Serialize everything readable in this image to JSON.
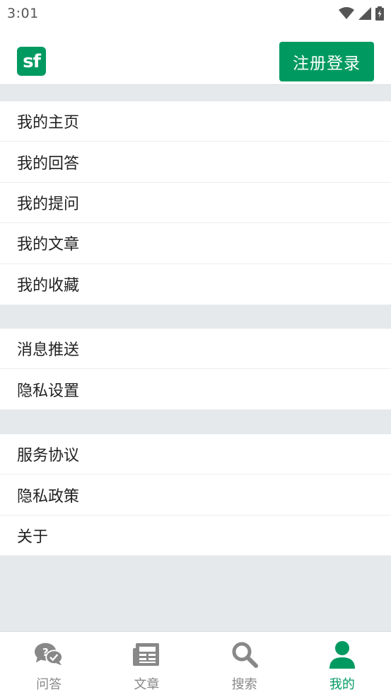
{
  "status_bar": {
    "time": "3:01"
  },
  "header": {
    "logo_text": "sf",
    "register_login_label": "注册登录"
  },
  "menu_groups": [
    {
      "items": [
        "我的主页",
        "我的回答",
        "我的提问",
        "我的文章",
        "我的收藏"
      ]
    },
    {
      "items": [
        "消息推送",
        "隐私设置"
      ]
    },
    {
      "items": [
        "服务协议",
        "隐私政策",
        "关于"
      ]
    }
  ],
  "tabs": [
    {
      "label": "问答",
      "icon": "qa-bubbles-icon"
    },
    {
      "label": "文章",
      "icon": "article-newspaper-icon"
    },
    {
      "label": "搜索",
      "icon": "search-icon"
    },
    {
      "label": "我的",
      "icon": "user-icon",
      "active": true
    }
  ],
  "colors": {
    "brand": "#009a61",
    "inactive": "#888888",
    "background": "#e6e9ec"
  }
}
